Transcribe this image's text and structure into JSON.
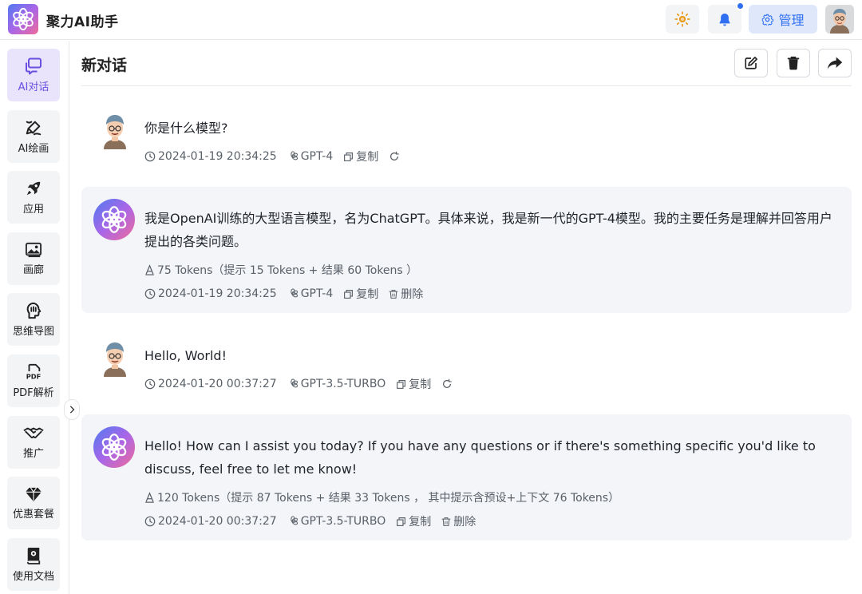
{
  "app": {
    "title": "聚力AI助手"
  },
  "topbar": {
    "admin_label": "管理"
  },
  "sidebar": {
    "items": [
      {
        "label": "AI对话",
        "icon": "chat-bubbles-icon",
        "active": true
      },
      {
        "label": "AI绘画",
        "icon": "brush-icon"
      },
      {
        "label": "应用",
        "icon": "rocket-icon"
      },
      {
        "label": "画廊",
        "icon": "images-icon"
      },
      {
        "label": "思维导图",
        "icon": "brain-head-icon"
      },
      {
        "label": "PDF解析",
        "icon": "pdf-icon"
      },
      {
        "label": "推广",
        "icon": "handshake-icon"
      },
      {
        "label": "优惠套餐",
        "icon": "diamond-icon"
      },
      {
        "label": "使用文档",
        "icon": "book-icon"
      }
    ]
  },
  "main": {
    "title": "新对话"
  },
  "messages": [
    {
      "role": "user",
      "text": "你是什么模型?",
      "time": "2024-01-19 20:34:25",
      "model": "GPT-4",
      "copy_label": "复制"
    },
    {
      "role": "assistant",
      "text": "我是OpenAI训练的大型语言模型，名为ChatGPT。具体来说，我是新一代的GPT-4模型。我的主要任务是理解并回答用户提出的各类问题。",
      "tokens": "75 Tokens（提示 15 Tokens + 结果 60 Tokens ）",
      "time": "2024-01-19 20:34:25",
      "model": "GPT-4",
      "copy_label": "复制",
      "delete_label": "删除"
    },
    {
      "role": "user",
      "text": "Hello, World!",
      "time": "2024-01-20 00:37:27",
      "model": "GPT-3.5-TURBO",
      "copy_label": "复制"
    },
    {
      "role": "assistant",
      "text": "Hello! How can I assist you today? If you have any questions or if there's something specific you'd like to discuss, feel free to let me know!",
      "tokens": "120 Tokens（提示 87 Tokens + 结果 33 Tokens ， 其中提示含预设+上下文 76 Tokens）",
      "time": "2024-01-20 00:37:27",
      "model": "GPT-3.5-TURBO",
      "copy_label": "复制",
      "delete_label": "删除"
    }
  ],
  "colors": {
    "accent": "#2f6ff2",
    "active_nav": "#6b4fe0",
    "theme_icon": "#e89b1b"
  }
}
